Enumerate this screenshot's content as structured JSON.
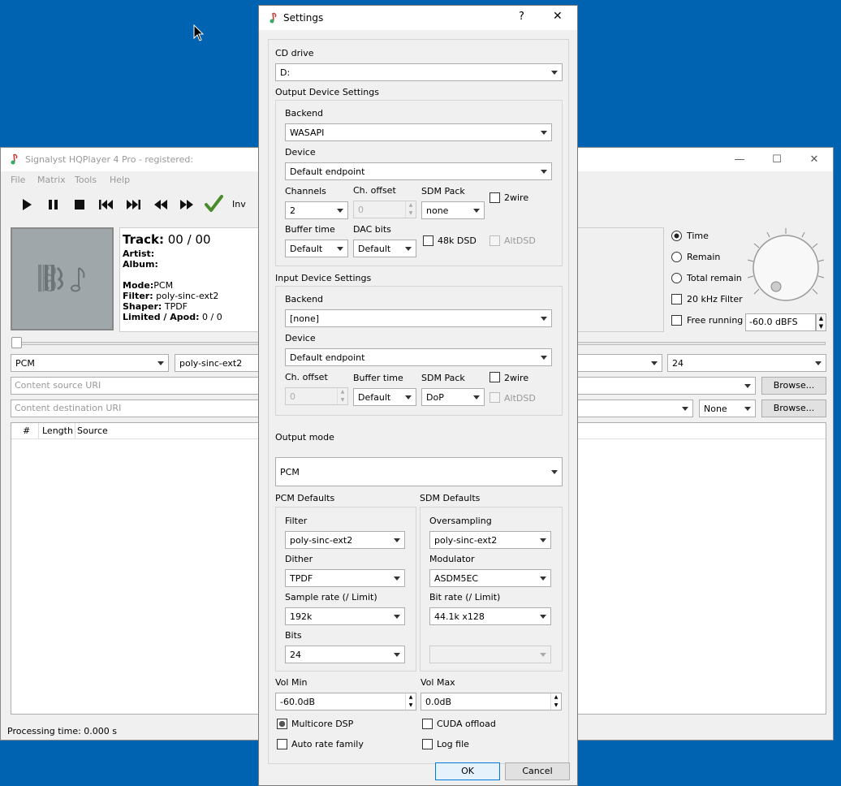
{
  "main_window": {
    "title": "Signalyst HQPlayer 4 Pro - registered:",
    "menu": [
      "File",
      "Matrix",
      "Tools",
      "Help"
    ],
    "toolbar": {
      "inv_label": "Inv"
    },
    "track": {
      "track_label": "Track:",
      "track_value": "00 / 00",
      "artist_label": "Artist:",
      "album_label": "Album:",
      "mode_label": "Mode:",
      "mode_value": "PCM",
      "filter_label": "Filter:",
      "filter_value": "poly-sinc-ext2",
      "shaper_label": "Shaper:",
      "shaper_value": "TPDF",
      "limited_label": "Limited / Apod:",
      "limited_value": "0 / 0"
    },
    "display": {
      "time": "Time",
      "remain": "Remain",
      "total_remain": "Total remain",
      "filter_20k": "20 kHz Filter",
      "free_running": "Free running",
      "volume": "-60.0 dBFS"
    },
    "combos": {
      "mode": "PCM",
      "filter": "poly-sinc-ext2",
      "bits": "24",
      "none": "None"
    },
    "content_source_placeholder": "Content source URI",
    "content_destination_placeholder": "Content destination URI",
    "browse_label": "Browse...",
    "columns": [
      "#",
      "Length",
      "Source"
    ],
    "status": "Processing time: 0.000 s"
  },
  "dialog": {
    "title": "Settings",
    "help": "?",
    "cd_drive_label": "CD drive",
    "cd_drive_value": "D:",
    "output_group": "Output Device Settings",
    "backend_label": "Backend",
    "output_backend": "WASAPI",
    "device_label": "Device",
    "output_device": "Default endpoint",
    "channels_label": "Channels",
    "channels_value": "2",
    "ch_offset_label": "Ch. offset",
    "ch_offset_value": "0",
    "sdm_pack_label": "SDM Pack",
    "output_sdm_pack": "none",
    "twowire_label": "2wire",
    "buffer_time_label": "Buffer time",
    "buffer_time_value": "Default",
    "dac_bits_label": "DAC bits",
    "dac_bits_value": "Default",
    "dsd48k_label": "48k DSD",
    "altdsd_label": "AltDSD",
    "input_group": "Input Device Settings",
    "input_backend": "[none]",
    "input_device": "Default endpoint",
    "input_ch_offset": "0",
    "input_buffer_time": "Default",
    "input_sdm_pack": "DoP",
    "output_mode_label": "Output mode",
    "output_mode_value": "PCM",
    "pcm_defaults": "PCM Defaults",
    "sdm_defaults": "SDM Defaults",
    "filter_label": "Filter",
    "filter_value": "poly-sinc-ext2",
    "dither_label": "Dither",
    "dither_value": "TPDF",
    "sample_rate_label": "Sample rate (/ Limit)",
    "sample_rate_value": "192k",
    "bits_label": "Bits",
    "bits_value": "24",
    "oversampling_label": "Oversampling",
    "oversampling_value": "poly-sinc-ext2",
    "modulator_label": "Modulator",
    "modulator_value": "ASDM5EC",
    "bit_rate_label": "Bit rate (/ Limit)",
    "bit_rate_value": "44.1k x128",
    "vol_min_label": "Vol Min",
    "vol_min_value": "-60.0dB",
    "vol_max_label": "Vol Max",
    "vol_max_value": "0.0dB",
    "multicore_label": "Multicore DSP",
    "cuda_label": "CUDA offload",
    "auto_rate_label": "Auto rate family",
    "log_file_label": "Log file",
    "ok_label": "OK",
    "cancel_label": "Cancel"
  }
}
